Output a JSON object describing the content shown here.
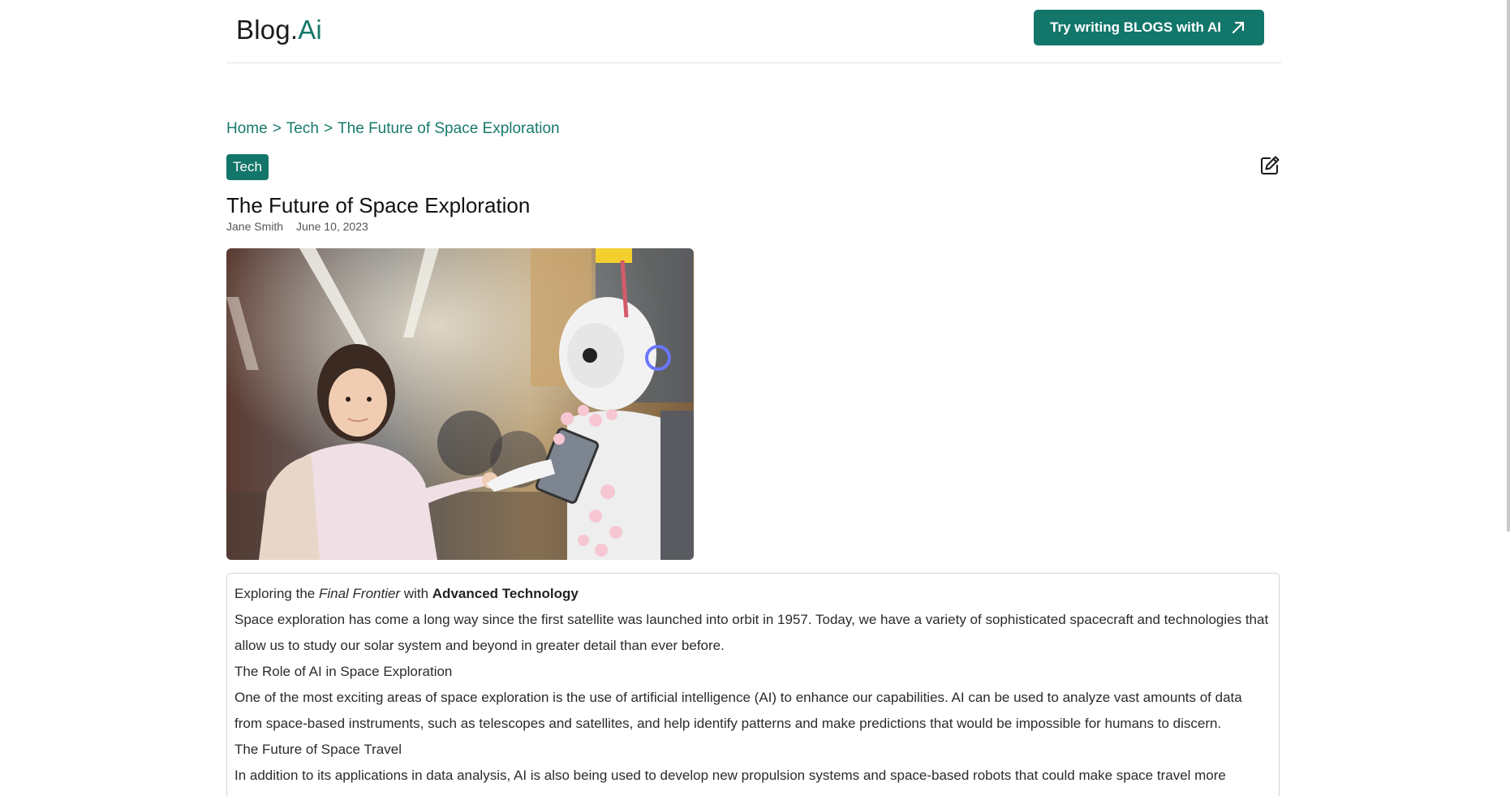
{
  "header": {
    "logo_main": "Blog.",
    "logo_accent": "Ai",
    "cta_label": "Try writing BLOGS with AI"
  },
  "breadcrumb": {
    "home": "Home",
    "separator": ">",
    "category": "Tech",
    "current": "The Future of Space Exploration"
  },
  "post": {
    "tag": "Tech",
    "title": "The Future of Space Exploration",
    "author": "Jane Smith",
    "date": "June 10, 2023"
  },
  "content": {
    "intro_prefix": "Exploring the ",
    "intro_italic": "Final Frontier",
    "intro_middle": " with ",
    "intro_bold": "Advanced Technology",
    "p1": "Space exploration has come a long way since the first satellite was launched into orbit in 1957. Today, we have a variety of sophisticated spacecraft and technologies that allow us to study our solar system and beyond in greater detail than ever before.",
    "h1": "The Role of AI in Space Exploration",
    "p2": "One of the most exciting areas of space exploration is the use of artificial intelligence (AI) to enhance our capabilities. AI can be used to analyze vast amounts of data from space-based instruments, such as telescopes and satellites, and help identify patterns and make predictions that would be impossible for humans to discern.",
    "h2": "The Future of Space Travel",
    "p3": "In addition to its applications in data analysis, AI is also being used to develop new propulsion systems and space-based robots that could make space travel more efficient and safer."
  },
  "colors": {
    "brand": "#12766a",
    "brand_text": "#17796b"
  },
  "icons": {
    "cta": "arrow-up-right-icon",
    "edit": "edit-icon"
  }
}
